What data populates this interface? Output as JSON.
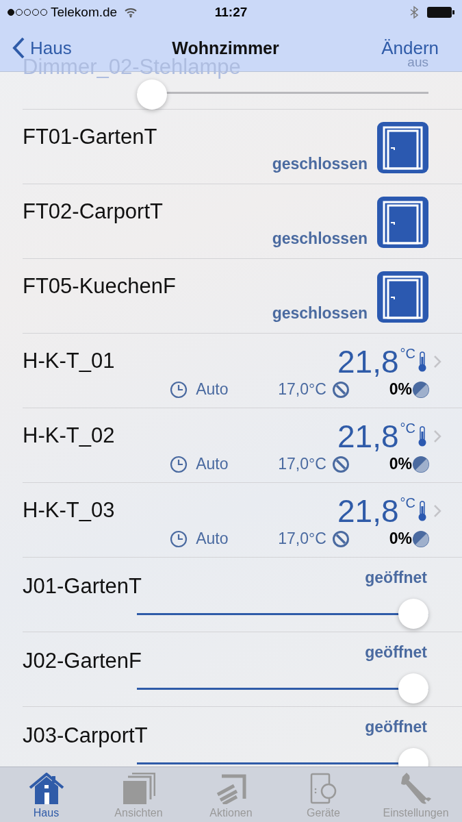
{
  "status_bar": {
    "carrier": "Telekom.de",
    "time": "11:27"
  },
  "nav": {
    "back": "Haus",
    "title": "Wohnzimmer",
    "action": "Ändern"
  },
  "devices": [
    {
      "kind": "dimmer",
      "name": "Dimmer_02-Stehlampe",
      "reading": "aus",
      "level": 0.0
    },
    {
      "kind": "window",
      "name": "FT01-GartenT",
      "status": "geschlossen"
    },
    {
      "kind": "window",
      "name": "FT02-CarportT",
      "status": "geschlossen"
    },
    {
      "kind": "window",
      "name": "FT05-KuechenF",
      "status": "geschlossen"
    },
    {
      "kind": "thermostat",
      "name": "H-K-T_01",
      "temperature": "21,8",
      "unit": "°C",
      "mode": "Auto",
      "setpoint": "17,0°C",
      "valve": "0%"
    },
    {
      "kind": "thermostat",
      "name": "H-K-T_02",
      "temperature": "21,8",
      "unit": "°C",
      "mode": "Auto",
      "setpoint": "17,0°C",
      "valve": "0%"
    },
    {
      "kind": "thermostat",
      "name": "H-K-T_03",
      "temperature": "21,8",
      "unit": "°C",
      "mode": "Auto",
      "setpoint": "17,0°C",
      "valve": "0%"
    },
    {
      "kind": "shutter",
      "name": "J01-GartenT",
      "status": "geöffnet",
      "level": 1.0
    },
    {
      "kind": "shutter",
      "name": "J02-GartenF",
      "status": "geöffnet",
      "level": 1.0
    },
    {
      "kind": "shutter",
      "name": "J03-CarportT",
      "status": "geöffnet",
      "level": 1.0
    }
  ],
  "tabs": [
    {
      "label": "Haus",
      "selected": true
    },
    {
      "label": "Ansichten",
      "selected": false
    },
    {
      "label": "Aktionen",
      "selected": false
    },
    {
      "label": "Geräte",
      "selected": false
    },
    {
      "label": "Einstellungen",
      "selected": false
    }
  ]
}
